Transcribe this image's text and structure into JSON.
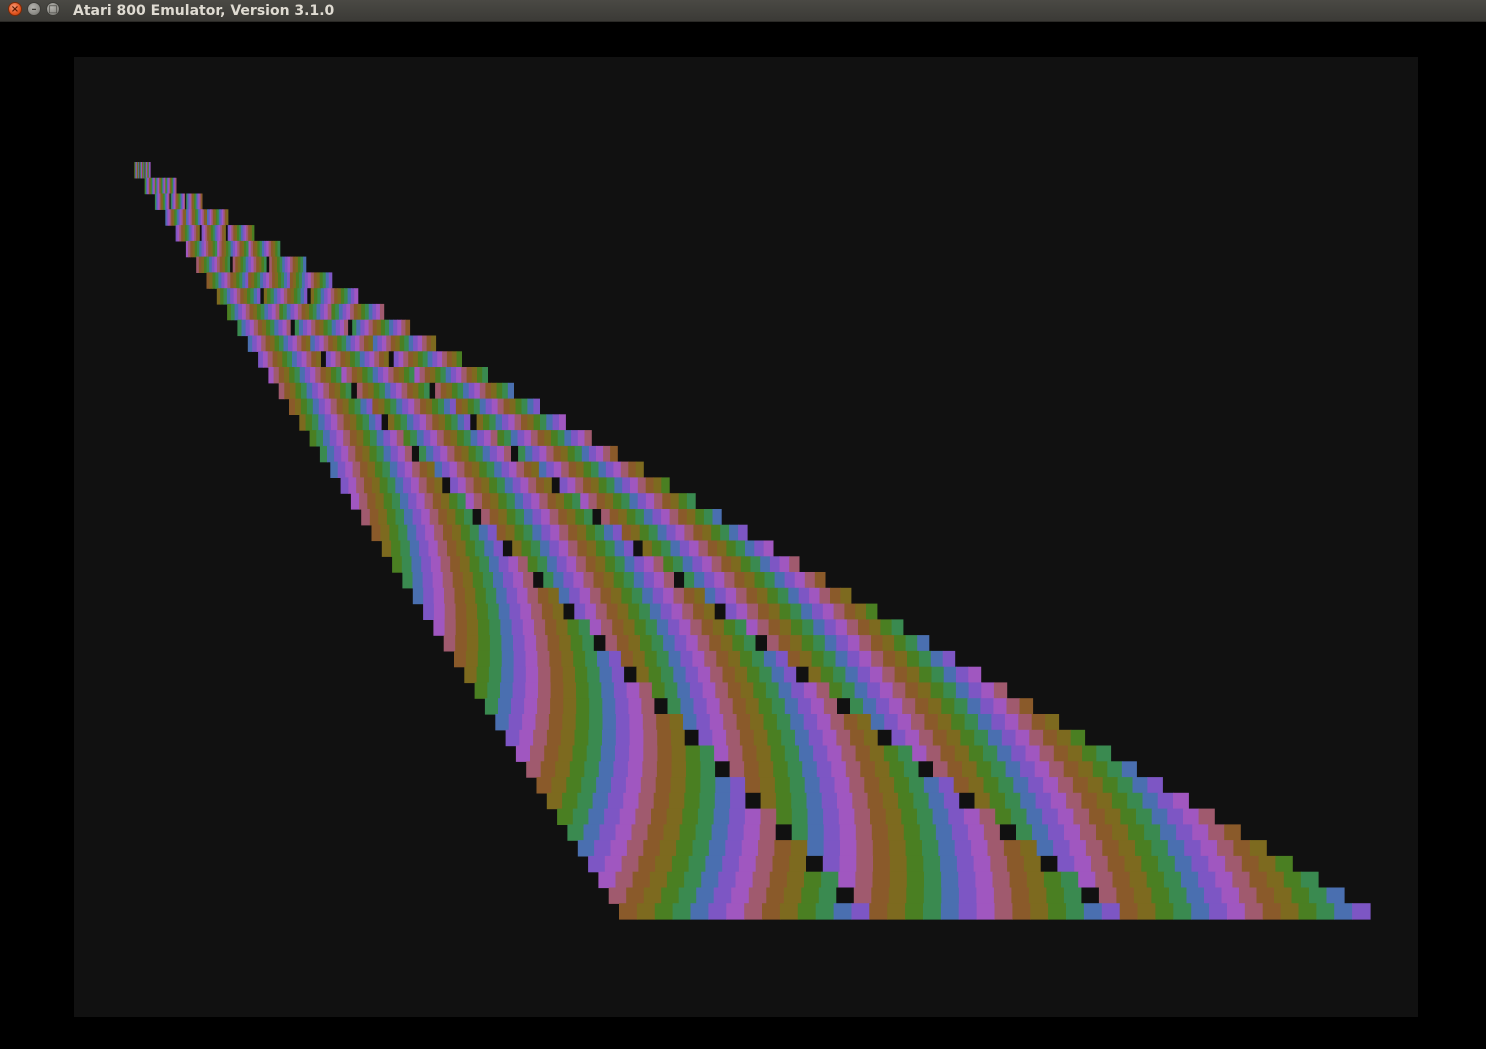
{
  "window": {
    "title": "Atari 800 Emulator, Version 3.1.0",
    "close_glyph": "×",
    "min_glyph": "–",
    "max_glyph": "□"
  },
  "icons": {
    "close": "close-icon",
    "minimize": "minimize-icon",
    "maximize": "maximize-icon"
  },
  "screen": {
    "background": "#111111",
    "palette": [
      "#7d6a1f",
      "#4a7f22",
      "#3a8a50",
      "#4a6fb0",
      "#7d56c4",
      "#a057c0",
      "#a05a6e",
      "#8a5a2a"
    ],
    "gap_color": "#111111"
  }
}
